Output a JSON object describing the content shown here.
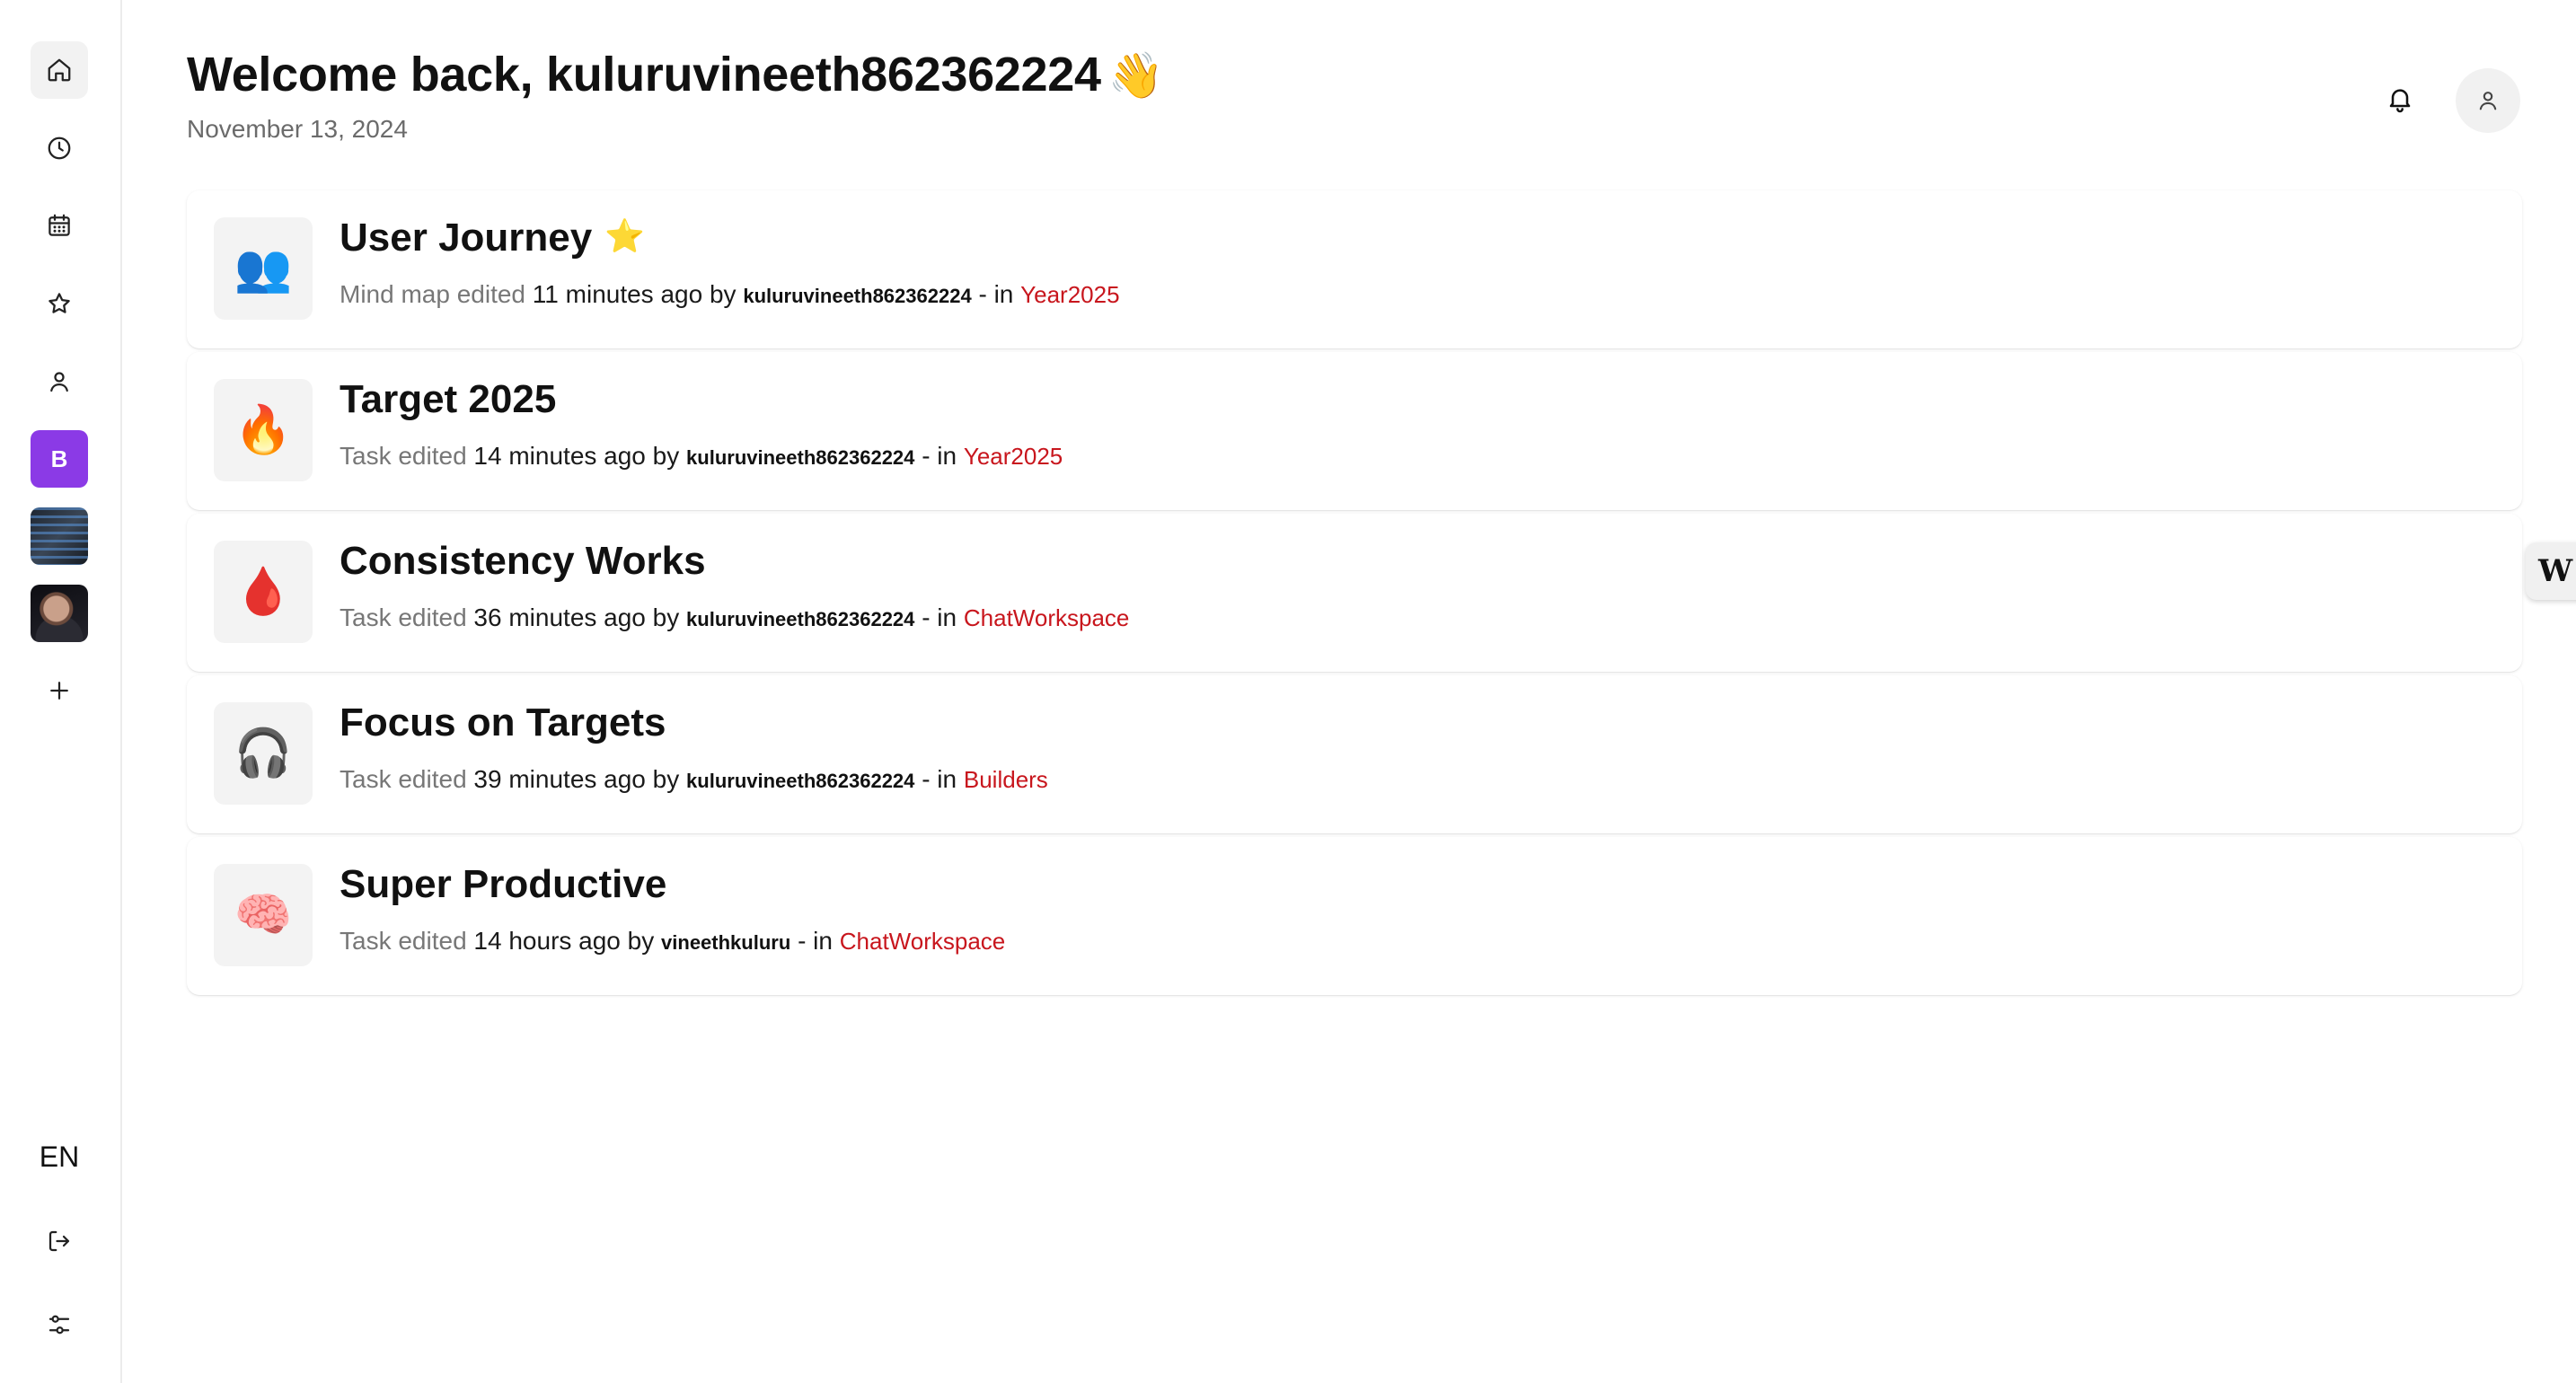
{
  "sidebar": {
    "nav": [
      {
        "name": "home",
        "icon": "home-icon",
        "active": true
      },
      {
        "name": "recent",
        "icon": "clock-icon"
      },
      {
        "name": "calendar",
        "icon": "calendar-icon"
      },
      {
        "name": "favorites",
        "icon": "star-icon"
      },
      {
        "name": "profile",
        "icon": "user-icon"
      }
    ],
    "workspaces": [
      {
        "letter": "B",
        "color": "#8b3ae6"
      }
    ],
    "language": "EN"
  },
  "header": {
    "title": "Welcome back, kuluruvineeth862362224",
    "title_emoji": "👋",
    "date": "November 13, 2024"
  },
  "activities": [
    {
      "icon": "👥",
      "title": "User Journey",
      "star": "⭐",
      "action": "Mind map edited",
      "time": "11 minutes ago",
      "by": "by",
      "user": "kuluruvineeth862362224",
      "sep": "- in",
      "workspace": "Year2025"
    },
    {
      "icon": "🔥",
      "title": "Target 2025",
      "star": "",
      "action": "Task edited",
      "time": "14 minutes ago",
      "by": "by",
      "user": "kuluruvineeth862362224",
      "sep": "- in",
      "workspace": "Year2025"
    },
    {
      "icon": "🩸",
      "title": "Consistency Works",
      "star": "",
      "action": "Task edited",
      "time": "36 minutes ago",
      "by": "by",
      "user": "kuluruvineeth862362224",
      "sep": "- in",
      "workspace": "ChatWorkspace"
    },
    {
      "icon": "🎧",
      "title": "Focus on Targets",
      "star": "",
      "action": "Task edited",
      "time": "39 minutes ago",
      "by": "by",
      "user": "kuluruvineeth862362224",
      "sep": "- in",
      "workspace": "Builders"
    },
    {
      "icon": "🧠",
      "title": "Super Productive",
      "star": "",
      "action": "Task edited",
      "time": "14 hours ago",
      "by": "by",
      "user": "vineethkuluru",
      "sep": "- in",
      "workspace": "ChatWorkspace"
    }
  ],
  "floating_tab": {
    "label": "W"
  },
  "colors": {
    "accent_workspace": "#c8161d",
    "workspace_b": "#8b3ae6"
  }
}
